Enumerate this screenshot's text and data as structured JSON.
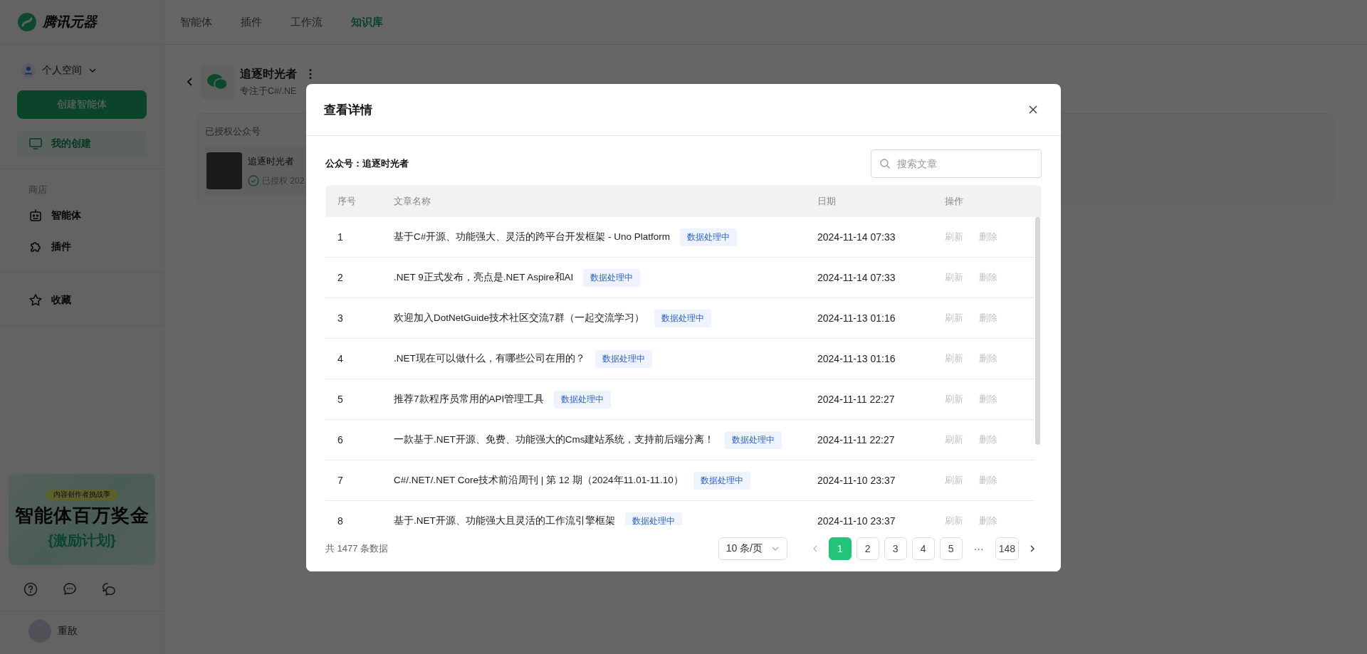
{
  "sidebar": {
    "brand": "腾讯元器",
    "space": "个人空间",
    "create_button": "创建智能体",
    "items": [
      {
        "label": "我的创建",
        "selected": true
      }
    ],
    "store_title": "商店",
    "store_items": [
      {
        "label": "智能体",
        "selected": false
      },
      {
        "label": "插件",
        "selected": false
      }
    ],
    "extra_items": [
      {
        "label": "收藏",
        "selected": false
      }
    ],
    "banner": {
      "badge": "内容创作者挑战季",
      "title": "智能体百万奖金",
      "subtitle": "{激励计划}"
    },
    "user": "重敔"
  },
  "top_nav": [
    {
      "label": "智能体",
      "selected": false
    },
    {
      "label": "插件",
      "selected": false
    },
    {
      "label": "工作流",
      "selected": false
    },
    {
      "label": "知识库",
      "selected": true
    }
  ],
  "page": {
    "title": "追逐时光者",
    "subtitle": "专注于C#/.NE",
    "section_title": "已授权公众号",
    "account": {
      "name": "追逐时光者",
      "status": "已授权 202"
    }
  },
  "modal": {
    "title": "查看详情",
    "account": "公众号：追逐时光者",
    "search": {
      "placeholder": "搜索文章"
    },
    "columns": [
      "序号",
      "文章名称",
      "日期",
      "操作"
    ],
    "rows": [
      {
        "index": "1",
        "title": "基于C#开源、功能强大、灵活的跨平台开发框架 - Uno Platform",
        "tag": "数据处理中",
        "date": "2024-11-14 07:33",
        "actions": [
          {
            "label": "刷新",
            "disabled": true
          },
          {
            "label": "删除",
            "disabled": true
          }
        ]
      },
      {
        "index": "2",
        "title": ".NET 9正式发布，亮点是.NET Aspire和AI",
        "tag": "数据处理中",
        "date": "2024-11-14 07:33",
        "actions": [
          {
            "label": "刷新",
            "disabled": true
          },
          {
            "label": "删除",
            "disabled": true
          }
        ]
      },
      {
        "index": "3",
        "title": "欢迎加入DotNetGuide技术社区交流7群（一起交流学习）",
        "tag": "数据处理中",
        "date": "2024-11-13 01:16",
        "actions": [
          {
            "label": "刷新",
            "disabled": true
          },
          {
            "label": "删除",
            "disabled": true
          }
        ]
      },
      {
        "index": "4",
        "title": ".NET现在可以做什么，有哪些公司在用的？",
        "tag": "数据处理中",
        "date": "2024-11-13 01:16",
        "actions": [
          {
            "label": "刷新",
            "disabled": true
          },
          {
            "label": "删除",
            "disabled": true
          }
        ]
      },
      {
        "index": "5",
        "title": "推荐7款程序员常用的API管理工具",
        "tag": "数据处理中",
        "date": "2024-11-11 22:27",
        "actions": [
          {
            "label": "刷新",
            "disabled": true
          },
          {
            "label": "删除",
            "disabled": true
          }
        ]
      },
      {
        "index": "6",
        "title": "一款基于.NET开源、免费、功能强大的Cms建站系统，支持前后端分离！",
        "tag": "数据处理中",
        "date": "2024-11-11 22:27",
        "actions": [
          {
            "label": "刷新",
            "disabled": true
          },
          {
            "label": "删除",
            "disabled": true
          }
        ]
      },
      {
        "index": "7",
        "title": "C#/.NET/.NET Core技术前沿周刊 | 第 12 期（2024年11.01-11.10）",
        "tag": "数据处理中",
        "date": "2024-11-10 23:37",
        "actions": [
          {
            "label": "刷新",
            "disabled": true
          },
          {
            "label": "删除",
            "disabled": true
          }
        ]
      },
      {
        "index": "8",
        "title": "基于.NET开源、功能强大且灵活的工作流引擎框架",
        "tag": "数据处理中",
        "date": "2024-11-10 23:37",
        "actions": [
          {
            "label": "刷新",
            "disabled": true
          },
          {
            "label": "删除",
            "disabled": true
          }
        ]
      }
    ],
    "total": "共 1477 条数据",
    "page_size": "10 条/页",
    "prev_disabled": true,
    "next_disabled": false,
    "pages": [
      {
        "label": "1",
        "kind": "page",
        "selected": true
      },
      {
        "label": "2",
        "kind": "page",
        "selected": false
      },
      {
        "label": "3",
        "kind": "page",
        "selected": false
      },
      {
        "label": "4",
        "kind": "page",
        "selected": false
      },
      {
        "label": "5",
        "kind": "page",
        "selected": false
      },
      {
        "label": "···",
        "kind": "ellipsis",
        "selected": false
      },
      {
        "label": "148",
        "kind": "page",
        "selected": false
      }
    ]
  }
}
